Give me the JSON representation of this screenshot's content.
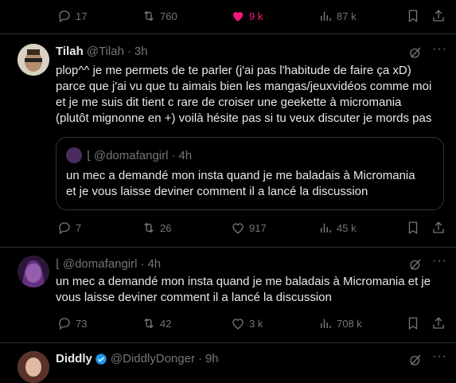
{
  "top_actions": {
    "replies": "17",
    "reposts": "760",
    "likes": "9 k",
    "views": "87 k"
  },
  "tweet1": {
    "name": "Tilah",
    "handle": "@Tilah",
    "time": "3h",
    "text_lines": [
      "plop^^ je me permets de te parler (j'ai pas l'habitude de faire ça xD)",
      "parce que j'ai vu que tu aimais bien les mangas/jeuxvidéos comme moi",
      "et je me suis dit tient c rare de croiser une geekette à micromania",
      "(plutôt mignonne en +) voilà hésite pas si tu veux discuter je mords pas"
    ],
    "quote": {
      "handle": "@domafangirl",
      "time": "4h",
      "text_lines": [
        "un mec a demandé mon insta quand je me baladais à Micromania",
        "et je vous laisse deviner comment il a lancé la discussion"
      ]
    },
    "actions": {
      "replies": "7",
      "reposts": "26",
      "likes": "917",
      "views": "45 k"
    }
  },
  "tweet2": {
    "handle": "@domafangirl",
    "time": "4h",
    "text_lines": [
      "un mec a demandé mon insta quand je me baladais à Micromania et je",
      "vous laisse deviner comment il a lancé la discussion"
    ],
    "actions": {
      "replies": "73",
      "reposts": "42",
      "likes": "3 k",
      "views": "708 k"
    }
  },
  "tweet3": {
    "name": "Diddly",
    "handle": "@DiddlyDonger",
    "time": "9h"
  },
  "colors": {
    "bg": "#000000",
    "text": "#e7e9ea",
    "muted": "#71767b",
    "like": "#f91880",
    "verified": "#1d9bf0"
  }
}
